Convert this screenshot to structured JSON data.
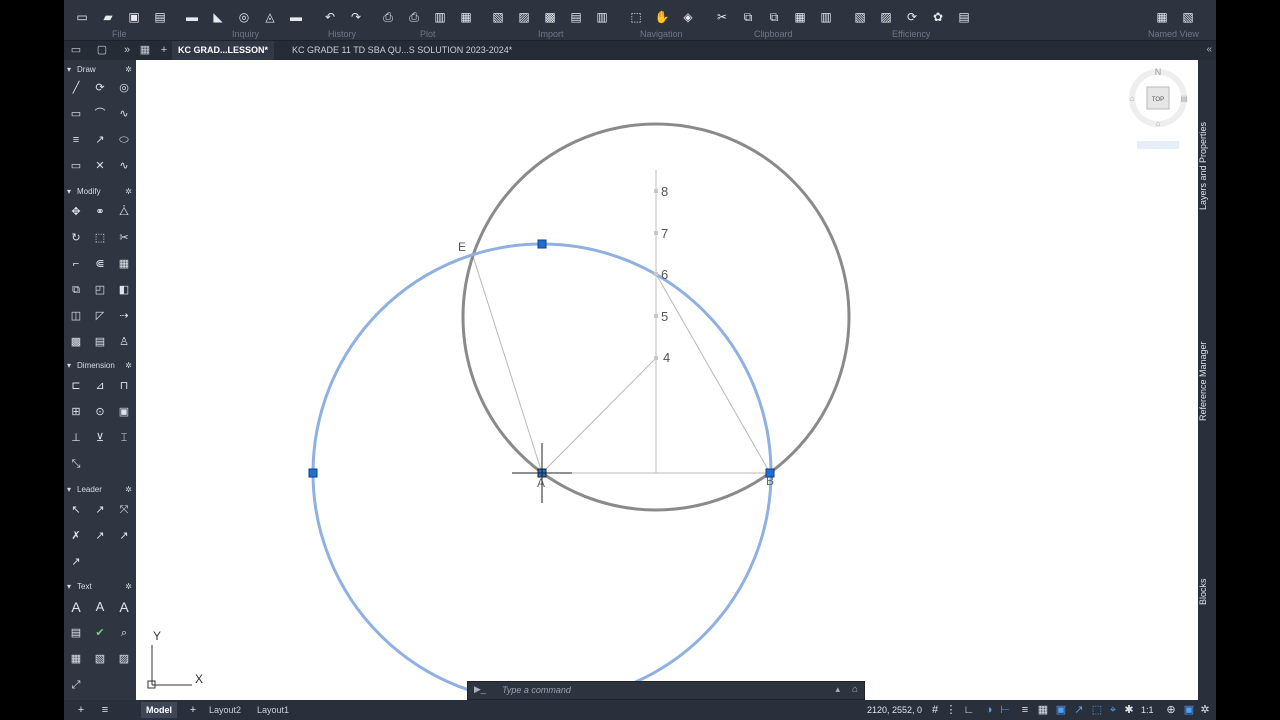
{
  "ribbon": {
    "groups": [
      "File",
      "Inquiry",
      "History",
      "Plot",
      "Import",
      "Navigation",
      "Clipboard",
      "Efficiency",
      "Named View"
    ]
  },
  "tabs": {
    "active": "KC GRAD...LESSON*",
    "second": "KC GRADE 11 TD SBA QU...S SOLUTION 2023-2024*"
  },
  "palette": {
    "sections": [
      "Draw",
      "Modify",
      "Dimension",
      "Leader",
      "Text"
    ]
  },
  "drawing": {
    "points": [
      "A",
      "B",
      "E"
    ],
    "scale_numbers": [
      "8",
      "7",
      "6",
      "5",
      "4"
    ],
    "view_cube_label": "TOP",
    "view_cube_north": "N",
    "ucs_x": "X",
    "ucs_y": "Y"
  },
  "right_panels": [
    "Layers and Properties",
    "Reference Manager",
    "Blocks"
  ],
  "command": {
    "placeholder": "Type a command",
    "prompt": "▶_"
  },
  "status": {
    "tabs": [
      "Model",
      "Layout2",
      "Layout1"
    ],
    "coords": "2120, 2552, 0",
    "scale": "1:1"
  },
  "colors": {
    "accent": "#1e6fd0",
    "selected_circle": "#8fb0e0",
    "circle": "#8a8a8a"
  }
}
